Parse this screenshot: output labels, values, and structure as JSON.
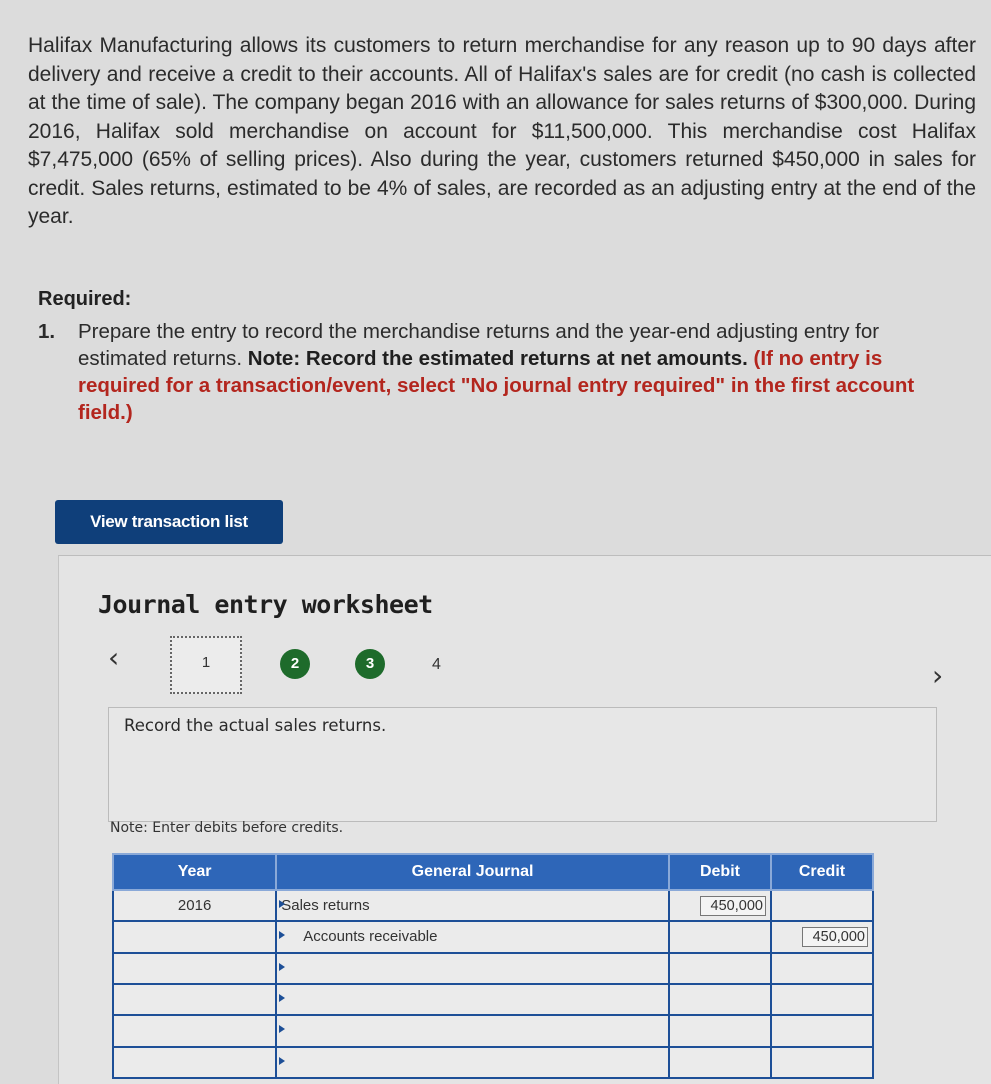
{
  "problem": {
    "text": "Halifax Manufacturing allows its customers to return merchandise for any reason up to 90 days after delivery and receive a credit to their accounts. All of Halifax's sales are for credit (no cash is collected at the time of sale). The company began 2016 with an allowance for sales returns of $300,000. During 2016, Halifax sold merchandise on account for $11,500,000. This merchandise cost Halifax $7,475,000 (65% of selling prices). Also during the year, customers returned $450,000 in sales for credit. Sales returns, estimated to be 4% of sales, are recorded as an adjusting entry at the end of the year."
  },
  "required": {
    "label": "Required:",
    "item_number": "1.",
    "item_text": "Prepare the entry to record the merchandise returns and the year-end adjusting entry for estimated returns.",
    "note_bold": "Note: Record the estimated returns at net amounts.",
    "note_red": "(If no entry is required for a transaction/event, select \"No journal entry required\" in the first account field.)"
  },
  "buttons": {
    "view_transaction_list": "View transaction list"
  },
  "worksheet": {
    "title": "Journal entry worksheet",
    "steps": [
      "1",
      "2",
      "3",
      "4"
    ],
    "prev_icon": "chevron-left-icon",
    "next_icon": "chevron-right-icon",
    "instruction": "Record the actual sales returns.",
    "note": "Note: Enter debits before credits.",
    "colors": {
      "header": "#2e66b8",
      "step_done": "#1e6b2b",
      "button": "#0f3f7a",
      "red_note": "#b3261e"
    }
  },
  "journal": {
    "headers": {
      "year": "Year",
      "general_journal": "General Journal",
      "debit": "Debit",
      "credit": "Credit"
    },
    "rows": [
      {
        "year": "2016",
        "account": "Sales returns",
        "debit": "450,000",
        "credit": ""
      },
      {
        "year": "",
        "account": "Accounts receivable",
        "debit": "",
        "credit": "450,000"
      },
      {
        "year": "",
        "account": "",
        "debit": "",
        "credit": ""
      },
      {
        "year": "",
        "account": "",
        "debit": "",
        "credit": ""
      },
      {
        "year": "",
        "account": "",
        "debit": "",
        "credit": ""
      },
      {
        "year": "",
        "account": "",
        "debit": "",
        "credit": ""
      }
    ]
  }
}
